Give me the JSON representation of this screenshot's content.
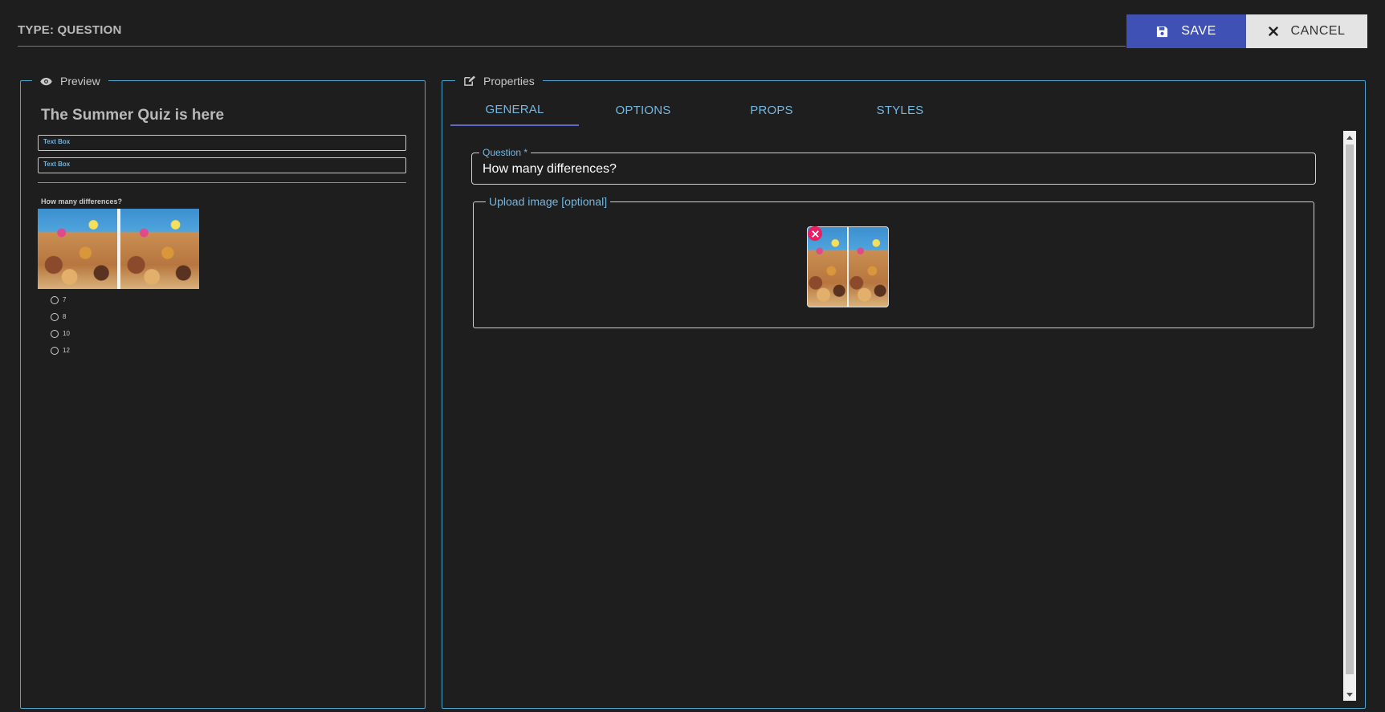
{
  "header": {
    "type_label": "TYPE: QUESTION",
    "save_label": "SAVE",
    "cancel_label": "CANCEL"
  },
  "preview": {
    "legend": "Preview",
    "quiz_title": "The Summer Quiz is here",
    "text_boxes": [
      "Text Box",
      "Text Box"
    ],
    "question": "How many differences?",
    "options": [
      "7",
      "8",
      "10",
      "12"
    ]
  },
  "properties": {
    "legend": "Properties",
    "tabs": [
      {
        "label": "GENERAL",
        "active": true
      },
      {
        "label": "OPTIONS",
        "active": false
      },
      {
        "label": "PROPS",
        "active": false
      },
      {
        "label": "STYLES",
        "active": false
      }
    ],
    "question_field": {
      "label": "Question *",
      "value": "How many differences?"
    },
    "upload": {
      "label": "Upload image [optional]"
    }
  },
  "colors": {
    "accent": "#3f51b5",
    "border": "#4aa3cc",
    "link": "#76b8e0",
    "remove": "#e91e63"
  }
}
